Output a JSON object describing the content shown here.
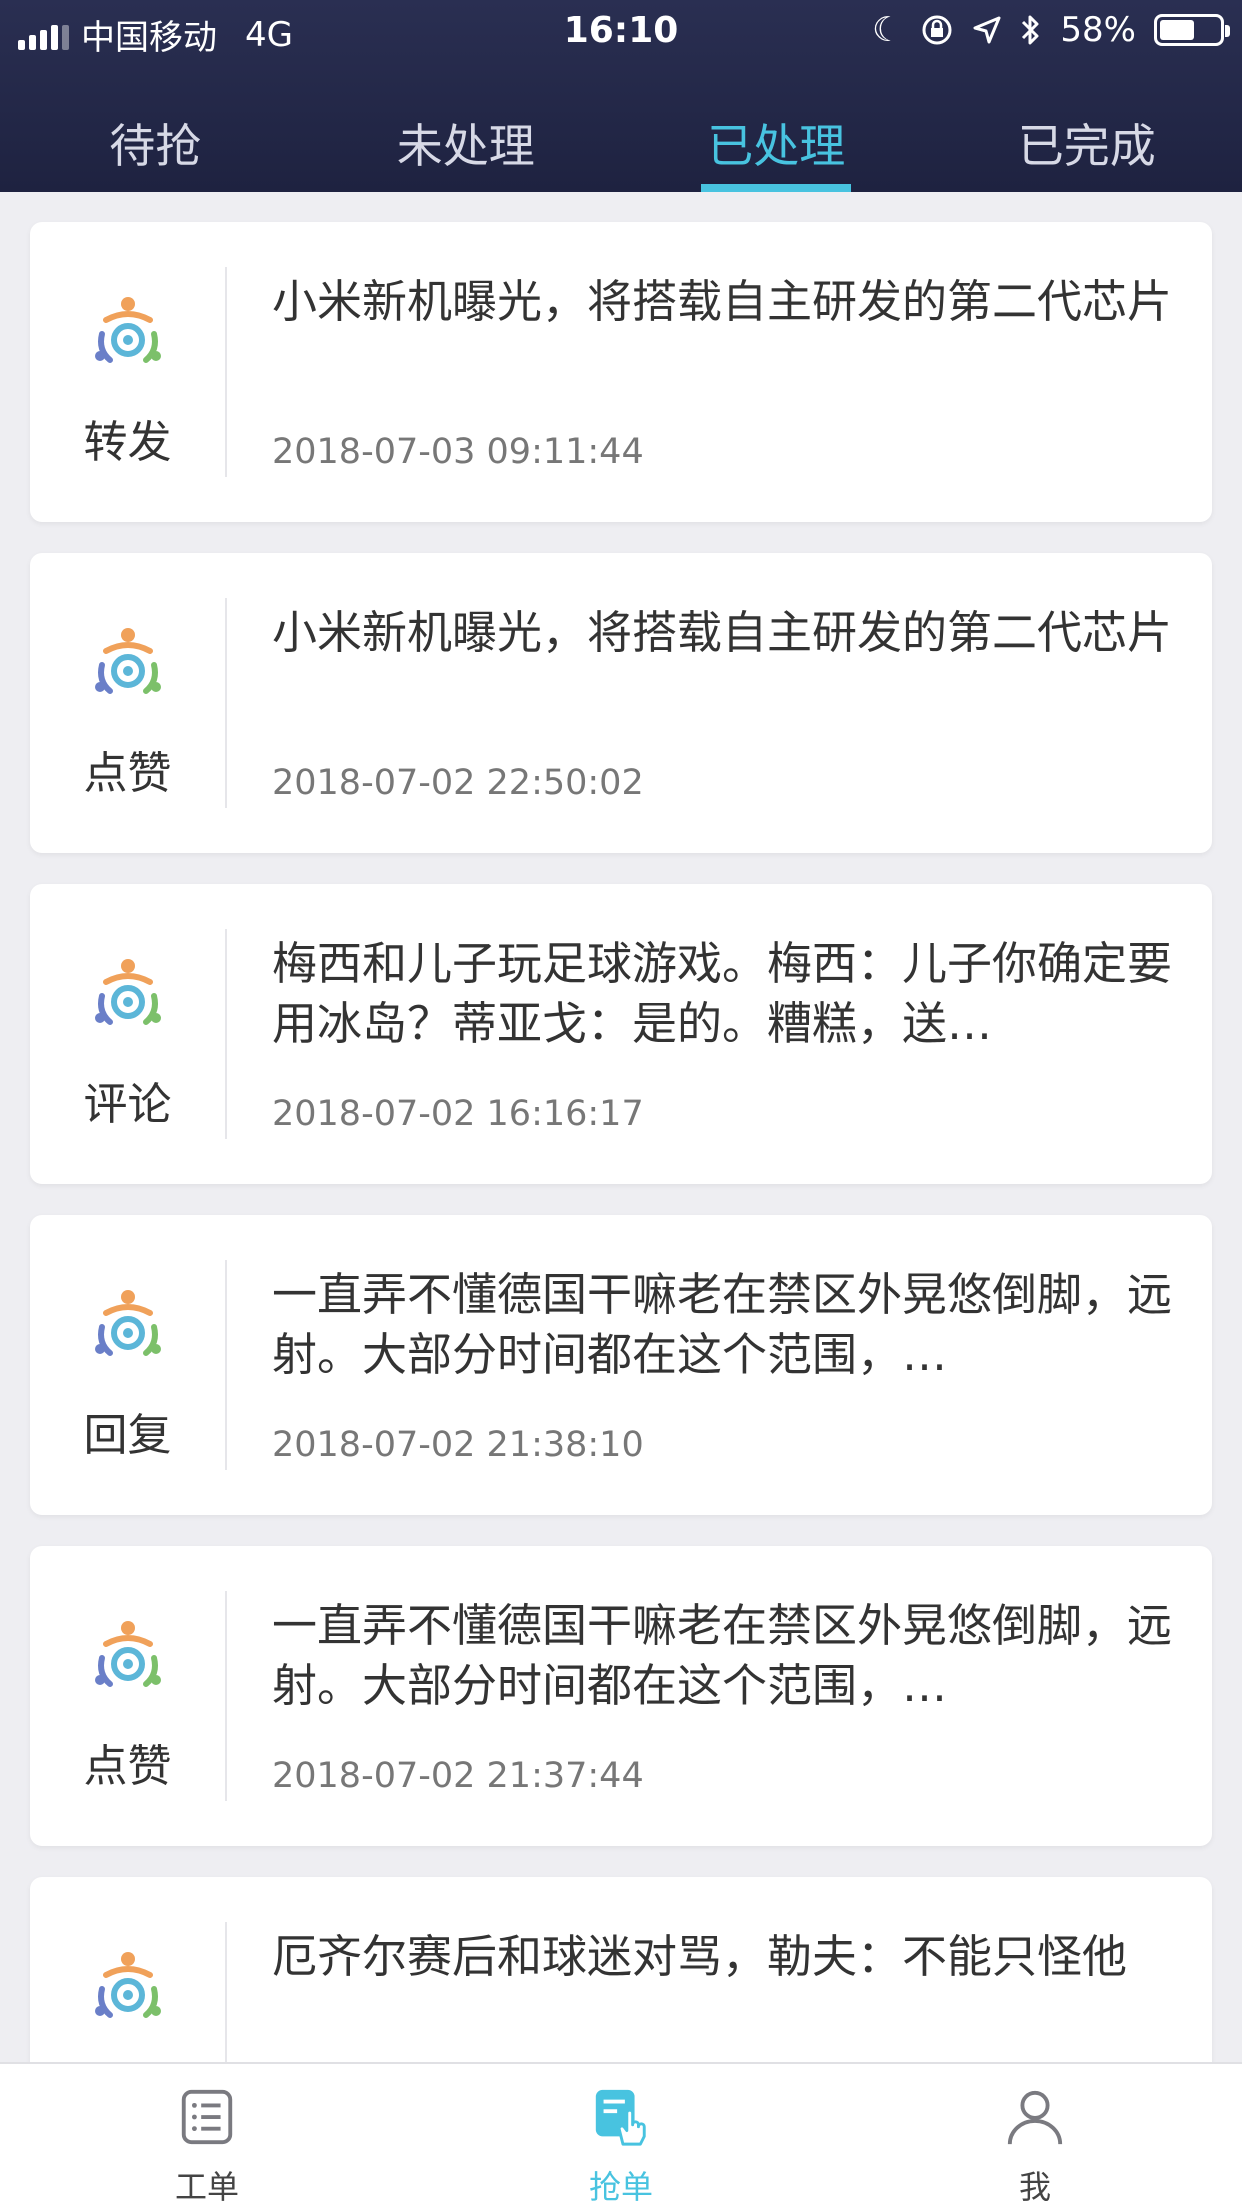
{
  "status_bar": {
    "carrier": "中国移动",
    "network": "4G",
    "time": "16:10",
    "battery": "58%",
    "battery_level": 0.58
  },
  "tabs": [
    {
      "label": "待抢",
      "active": false
    },
    {
      "label": "未处理",
      "active": false
    },
    {
      "label": "已处理",
      "active": true
    },
    {
      "label": "已完成",
      "active": false
    }
  ],
  "items": [
    {
      "type": "转发",
      "title": "小米新机曝光，将搭载自主研发的第二代芯片",
      "time": "2018-07-03 09:11:44"
    },
    {
      "type": "点赞",
      "title": "小米新机曝光，将搭载自主研发的第二代芯片",
      "time": "2018-07-02 22:50:02"
    },
    {
      "type": "评论",
      "title": "梅西和儿子玩足球游戏。梅西：儿子你确定要用冰岛？蒂亚戈：是的。糟糕，送…",
      "time": "2018-07-02 16:16:17"
    },
    {
      "type": "回复",
      "title": "一直弄不懂德国干嘛老在禁区外晃悠倒脚，远射。大部分时间都在这个范围，…",
      "time": "2018-07-02 21:38:10"
    },
    {
      "type": "点赞",
      "title": "一直弄不懂德国干嘛老在禁区外晃悠倒脚，远射。大部分时间都在这个范围，…",
      "time": "2018-07-02 21:37:44"
    },
    {
      "type": "",
      "title": "厄齐尔赛后和球迷对骂，勒夫：不能只怪他",
      "time": ""
    }
  ],
  "bottom_nav": [
    {
      "label": "工单",
      "icon": "worklist-icon",
      "active": false
    },
    {
      "label": "抢单",
      "icon": "grab-order-icon",
      "active": true
    },
    {
      "label": "我",
      "icon": "profile-icon",
      "active": false
    }
  ],
  "colors": {
    "header_bg": "#23284a",
    "accent": "#48c3e0",
    "page_bg": "#eeeef2"
  }
}
